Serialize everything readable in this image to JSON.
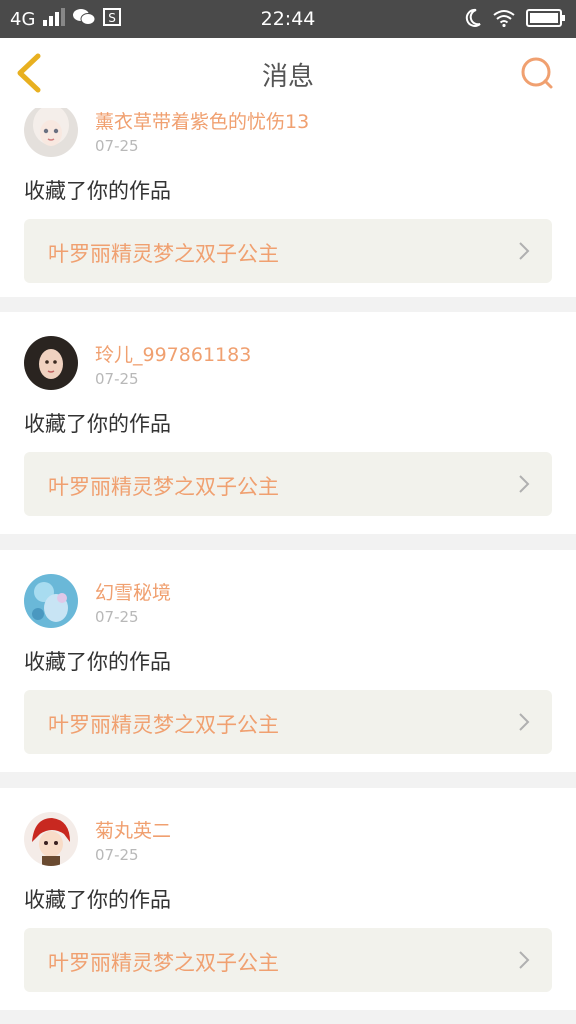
{
  "status_bar": {
    "network": "4G",
    "time": "22:44",
    "icons": [
      "signal-icon",
      "wechat-icon",
      "s-app-icon",
      "moon-icon",
      "wifi-icon",
      "battery-icon"
    ]
  },
  "header": {
    "title": "消息",
    "back_icon": "back-chevron-icon",
    "search_icon": "search-icon"
  },
  "messages": [
    {
      "username": "薰衣草带着紫色的忧伤13",
      "date": "07-25",
      "action": "收藏了你的作品",
      "work_title": "叶罗丽精灵梦之双子公主"
    },
    {
      "username": "玲儿_997861183",
      "date": "07-25",
      "action": "收藏了你的作品",
      "work_title": "叶罗丽精灵梦之双子公主"
    },
    {
      "username": "幻雪秘境",
      "date": "07-25",
      "action": "收藏了你的作品",
      "work_title": "叶罗丽精灵梦之双子公主"
    },
    {
      "username": "菊丸英二",
      "date": "07-25",
      "action": "收藏了你的作品",
      "work_title": "叶罗丽精灵梦之双子公主"
    }
  ],
  "colors": {
    "accent": "#f0a070",
    "back_icon": "#e8b020",
    "status_bar": "#4a4a4a"
  }
}
